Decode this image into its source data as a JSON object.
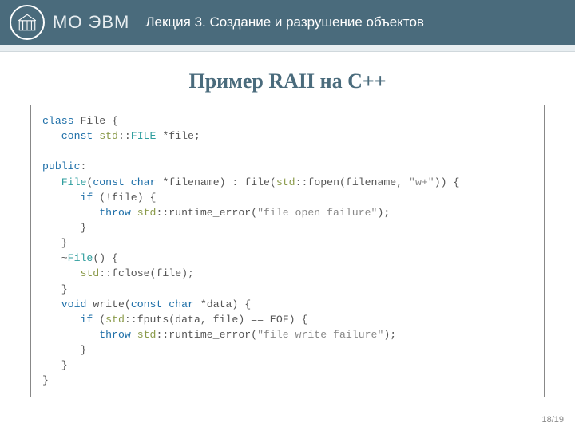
{
  "header": {
    "org": "МО ЭВМ",
    "lecture": "Лекция 3. Создание и разрушение объектов"
  },
  "title": "Пример RAII на C++",
  "code": {
    "l01_a": "class",
    "l01_b": " File {",
    "l02_a": "   const",
    "l02_b": " std",
    "l02_c": "::",
    "l02_d": "FILE",
    "l02_e": " *file;",
    "l03": "",
    "l04_a": "public",
    "l04_b": ":",
    "l05_a": "   File",
    "l05_b": "(",
    "l05_c": "const char",
    "l05_d": " *filename) : file(",
    "l05_e": "std",
    "l05_f": "::fopen(filename, ",
    "l05_g": "\"w+\"",
    "l05_h": ")) {",
    "l06_a": "      if",
    "l06_b": " (!file) {",
    "l07_a": "         throw",
    "l07_b": " std",
    "l07_c": "::runtime_error(",
    "l07_d": "\"file open failure\"",
    "l07_e": ");",
    "l08": "      }",
    "l09": "   }",
    "l10_a": "   ~",
    "l10_b": "File",
    "l10_c": "() {",
    "l11_a": "      std",
    "l11_b": "::fclose(file);",
    "l12": "   }",
    "l13_a": "   void",
    "l13_b": " write(",
    "l13_c": "const char",
    "l13_d": " *data) {",
    "l14_a": "      if",
    "l14_b": " (",
    "l14_c": "std",
    "l14_d": "::fputs(data, file) == EOF) {",
    "l15_a": "         throw",
    "l15_b": " std",
    "l15_c": "::runtime_error(",
    "l15_d": "\"file write failure\"",
    "l15_e": ");",
    "l16": "      }",
    "l17": "   }",
    "l18": "}"
  },
  "footer": "18/19"
}
